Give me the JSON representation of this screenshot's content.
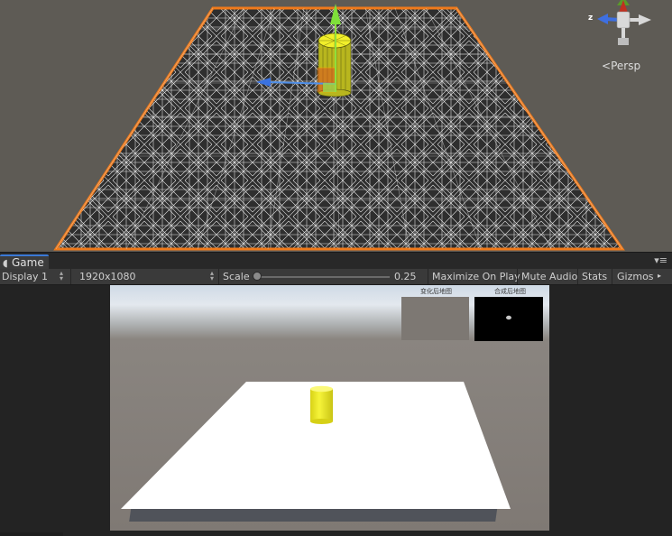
{
  "scene": {
    "view_mode": "Persp",
    "axis_labels": {
      "z": "z"
    }
  },
  "game": {
    "tab_label": "Game",
    "display": "Display 1",
    "resolution": "1920x1080",
    "scale_label": "Scale",
    "scale_value": 0.25,
    "scale_value_text": "0.25",
    "maximize_on_play": "Maximize On Play",
    "mute_audio": "Mute Audio",
    "stats": "Stats",
    "gizmos": "Gizmos"
  },
  "minimaps": {
    "left_title": "变化后地图",
    "right_title": "合成后地图"
  },
  "colors": {
    "scene_bg": "#5e5b55",
    "selection_outline": "#f07a1a",
    "tab_accent": "#3a79d6",
    "cylinder": "#f1ef2a",
    "toolbar_bg": "#3a3a3a"
  }
}
